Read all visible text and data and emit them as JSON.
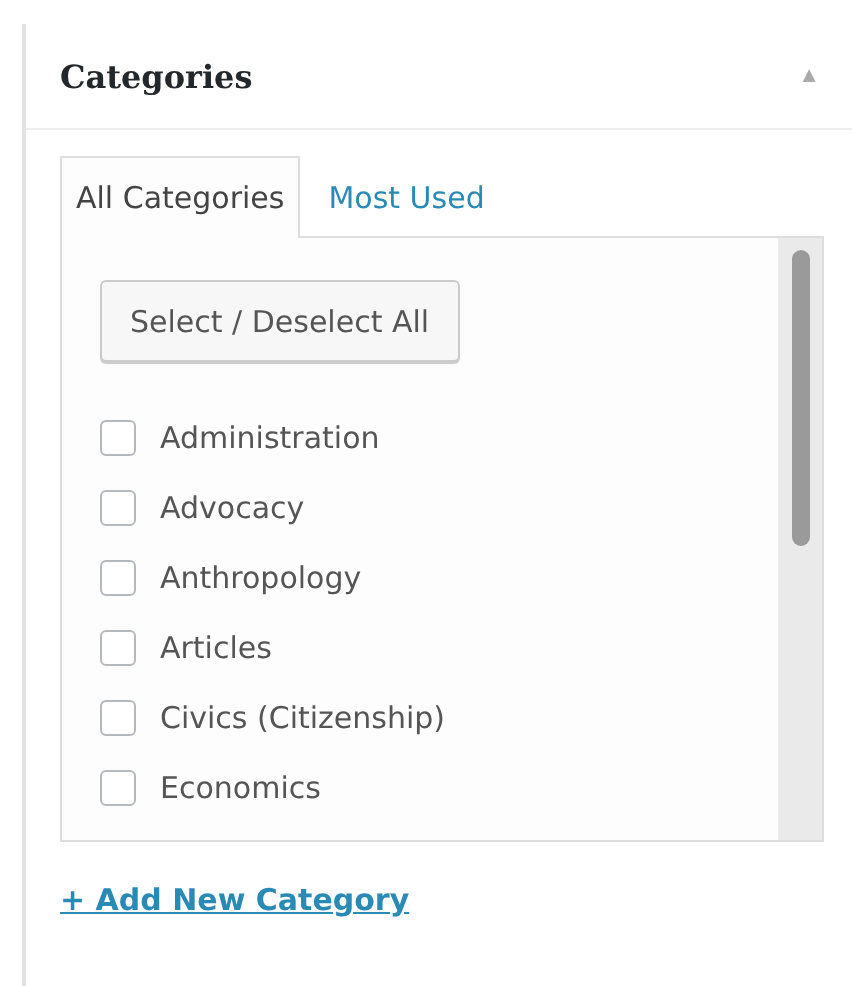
{
  "panel": {
    "title": "Categories",
    "collapse_icon": "▲"
  },
  "tabs": [
    {
      "label": "All Categories",
      "selected": true
    },
    {
      "label": "Most Used",
      "selected": false
    }
  ],
  "select_all_button": "Select / Deselect All",
  "categories": [
    {
      "label": "Administration",
      "checked": false
    },
    {
      "label": "Advocacy",
      "checked": false
    },
    {
      "label": "Anthropology",
      "checked": false
    },
    {
      "label": "Articles",
      "checked": false
    },
    {
      "label": "Civics (Citizenship)",
      "checked": false
    },
    {
      "label": "Economics",
      "checked": false
    }
  ],
  "add_link": "+ Add New Category"
}
